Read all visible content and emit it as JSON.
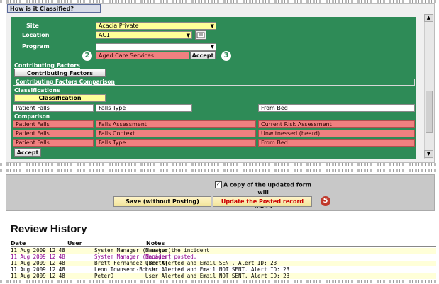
{
  "header_tab": "How is it Classified?",
  "form": {
    "site_label": "Site",
    "site_value": "Acacia Private",
    "location_label": "Location",
    "location_value": "AC1",
    "program_label": "Program",
    "program_value": "",
    "program_entry": "Aged Care Services.",
    "accept_label": "Accept",
    "badge_2": "2",
    "badge_3": "3"
  },
  "links": {
    "contributing_factors": "Contributing Factors",
    "contributing_factors_btn": "Contributing Factors",
    "cf_comparison": "Contributing Factors Comparison",
    "classifications": "Classifications",
    "classification_btn": "Classification"
  },
  "classification_row": [
    "Patient Falls",
    "Falls Type",
    "From Bed"
  ],
  "comparison": {
    "title": "Comparison",
    "rows": [
      [
        "Patient Falls",
        "Falls Assessment",
        "Current Risk Assessment"
      ],
      [
        "Patient Falls",
        "Falls Context",
        "Unwitnessed (heard)"
      ],
      [
        "Patient Falls",
        "Falls Type",
        "From Bed"
      ]
    ],
    "accept_label": "Accept"
  },
  "posting": {
    "copy_line1": "A copy of the updated form will",
    "copy_line2": "be available to all Authorised Users",
    "copy_checked": "✓",
    "save_label": "Save (without Posting)",
    "update_label": "Update the Posted record",
    "badge_5": "5"
  },
  "review": {
    "title": "Review History",
    "col_date": "Date",
    "col_user": "User",
    "col_notes": "Notes",
    "rows": [
      {
        "date": "11 Aug 2009 12:48",
        "user": "System Manager (Manager)",
        "notes": "Created the incident.",
        "highlight": false
      },
      {
        "date": "11 Aug 2009 12:48",
        "user": "System Manager (Manager)",
        "notes": "Incident posted.",
        "highlight": true
      },
      {
        "date": "11 Aug 2009 12:48",
        "user": "Brett Fernandez (Brett)",
        "notes": "User Alerted and Email SENT. Alert ID: 23",
        "highlight": false
      },
      {
        "date": "11 Aug 2009 12:48",
        "user": "Leon Townsend-Booth",
        "notes": "User Alerted and Email NOT SENT. Alert ID: 23",
        "highlight": false
      },
      {
        "date": "11 Aug 2009 12:48",
        "user": "PeterD",
        "notes": "User Alerted and Email NOT SENT. Alert ID: 23",
        "highlight": false
      }
    ]
  },
  "colors": {
    "panel_green": "#2e8b57",
    "field_yellow": "#ffff99",
    "field_pink": "#f08080",
    "highlight_text": "#8b008b",
    "badge_red": "#c0392b"
  }
}
